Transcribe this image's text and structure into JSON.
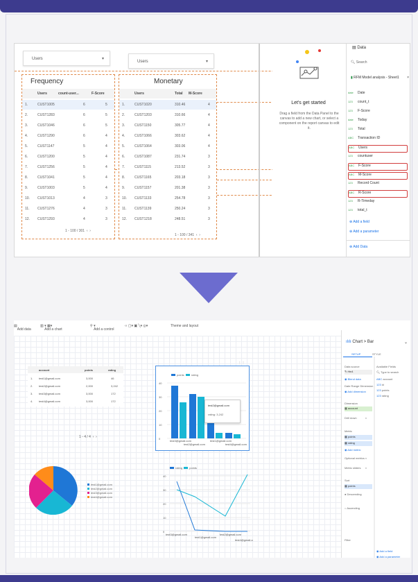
{
  "before": {
    "dropdown_left": "Users",
    "dropdown_right": "Users",
    "frequency": {
      "title": "Frequency",
      "headers": [
        "Users",
        "count-user...",
        "F-Score"
      ],
      "rows": [
        [
          "1.",
          "CUST1005",
          "6",
          "5"
        ],
        [
          "2.",
          "CUST1283",
          "6",
          "5"
        ],
        [
          "3.",
          "CUST1046",
          "6",
          "5"
        ],
        [
          "4.",
          "CUST1290",
          "6",
          "4"
        ],
        [
          "5.",
          "CUST1147",
          "5",
          "4"
        ],
        [
          "6.",
          "CUST1200",
          "5",
          "4"
        ],
        [
          "7.",
          "CUST1256",
          "5",
          "4"
        ],
        [
          "8.",
          "CUST1041",
          "5",
          "4"
        ],
        [
          "9.",
          "CUST1003",
          "5",
          "4"
        ],
        [
          "10.",
          "CUST1013",
          "4",
          "3"
        ],
        [
          "11.",
          "CUST1276",
          "4",
          "3"
        ],
        [
          "12.",
          "CUST1293",
          "4",
          "3"
        ]
      ],
      "pager": "1 - 100 / 301"
    },
    "monetary": {
      "title": "Monetary",
      "headers": [
        "Users",
        "Total",
        "M-Score"
      ],
      "rows": [
        [
          "1.",
          "CUST1020",
          "310.46",
          "4"
        ],
        [
          "2.",
          "CUST1203",
          "310.66",
          "4"
        ],
        [
          "3.",
          "CUST1150",
          "305.77",
          "4"
        ],
        [
          "4.",
          "CUST1066",
          "303.62",
          "4"
        ],
        [
          "5.",
          "CUST1064",
          "303.06",
          "4"
        ],
        [
          "6.",
          "CUST1087",
          "231.74",
          "3"
        ],
        [
          "7.",
          "CUST1115",
          "213.52",
          "3"
        ],
        [
          "8.",
          "CUST1165",
          "203.18",
          "3"
        ],
        [
          "9.",
          "CUST1157",
          "201.38",
          "3"
        ],
        [
          "10.",
          "CUST1133",
          "254.78",
          "3"
        ],
        [
          "11.",
          "CUST1139",
          "250.24",
          "3"
        ],
        [
          "12.",
          "CUST1218",
          "248.51",
          "3"
        ]
      ],
      "pager": "1 - 100 / 341"
    },
    "empty_state": {
      "title": "Let's get started",
      "text": "Drag a field from the Data Panel to the canvas to add a new chart, or select a component on the report canvas to edit it."
    },
    "panel": {
      "data_label": "Data",
      "search": "Search",
      "source": "RFM Model analysis - Sheet1",
      "fields": [
        {
          "label": "Date",
          "type": "date",
          "hl": false
        },
        {
          "label": "count_t",
          "type": "123",
          "hl": false
        },
        {
          "label": "F-Score",
          "type": "123",
          "hl": false
        },
        {
          "label": "Today",
          "type": "date",
          "hl": false
        },
        {
          "label": "Total",
          "type": "123",
          "hl": false
        },
        {
          "label": "Transaction ID",
          "type": "ABC",
          "hl": false
        },
        {
          "label": "Users",
          "type": "ABC",
          "hl": true
        },
        {
          "label": "countuser",
          "type": "123",
          "hl": false
        },
        {
          "label": "F-Score",
          "type": "ABC",
          "hl": true
        },
        {
          "label": "M-Score",
          "type": "ABC",
          "hl": true
        },
        {
          "label": "Record Count",
          "type": "123",
          "hl": false
        },
        {
          "label": "R-Score",
          "type": "ABC",
          "hl": true
        },
        {
          "label": "R-Timeday",
          "type": "123",
          "hl": false
        },
        {
          "label": "total_t",
          "type": "123",
          "hl": false
        }
      ],
      "add_field": "Add a field",
      "add_parameter": "Add a parameter",
      "add_data": "Add Data"
    }
  },
  "after": {
    "toolbar": [
      "Add data",
      "Add a chart",
      "Add a control",
      "Theme and layout"
    ],
    "table": {
      "headers": [
        "account",
        "points",
        "rating"
      ],
      "rows": [
        [
          "1.",
          "test1@gmail.com",
          "3,000",
          "46"
        ],
        [
          "2.",
          "test2@gmail.com",
          "2,000",
          "3,242"
        ],
        [
          "3.",
          "test3@gmail.com",
          "3,000",
          "172"
        ],
        [
          "4.",
          "test4@gmail.com",
          "3,000",
          "172"
        ]
      ],
      "pager": "1 - 4 / 4"
    },
    "bar_chart": {
      "legend": [
        "points",
        "rating"
      ],
      "tooltip_title": "test2@gmail.com",
      "tooltip_value": "rating: 3,242",
      "xlabels": [
        "test3@gmail.com",
        "test2@gmail.com",
        "test1@gmail.com",
        "test4@gmail.com"
      ]
    },
    "line_chart": {
      "legend": [
        "rating",
        "points"
      ],
      "xlabels": [
        "test3@gmail.com",
        "test1@gmail.com",
        "test2@gmail.com",
        "test4@gmail.com"
      ]
    },
    "pie_legend": [
      "test1@gmail.com",
      "test2@gmail.com",
      "test3@gmail.com",
      "test4@gmail.com"
    ],
    "panel": {
      "chart_label": "Chart > Bar",
      "tabs": [
        "SETUP",
        "STYLE"
      ],
      "data_source": "Data source",
      "source_name": "rfm4",
      "blend": "Blend data",
      "date_range": "Date Range Dimension",
      "dimension": "Dimension",
      "dimension_value": "account",
      "drill": "Drill down",
      "metric": "Metric",
      "metrics": [
        "points",
        "rating"
      ],
      "add_metric": "Add metric",
      "optional": "Optional metrics",
      "sliders": "Metric sliders",
      "sort": "Sort",
      "sort_value": "points",
      "descending": "Descending",
      "ascending": "Ascending",
      "filter": "Filter",
      "available": "Available Fields",
      "search": "Type to search",
      "available_fields": [
        "account",
        "id",
        "points",
        "rating"
      ],
      "add_field": "Add a field",
      "add_param": "Add a parameter"
    }
  }
}
